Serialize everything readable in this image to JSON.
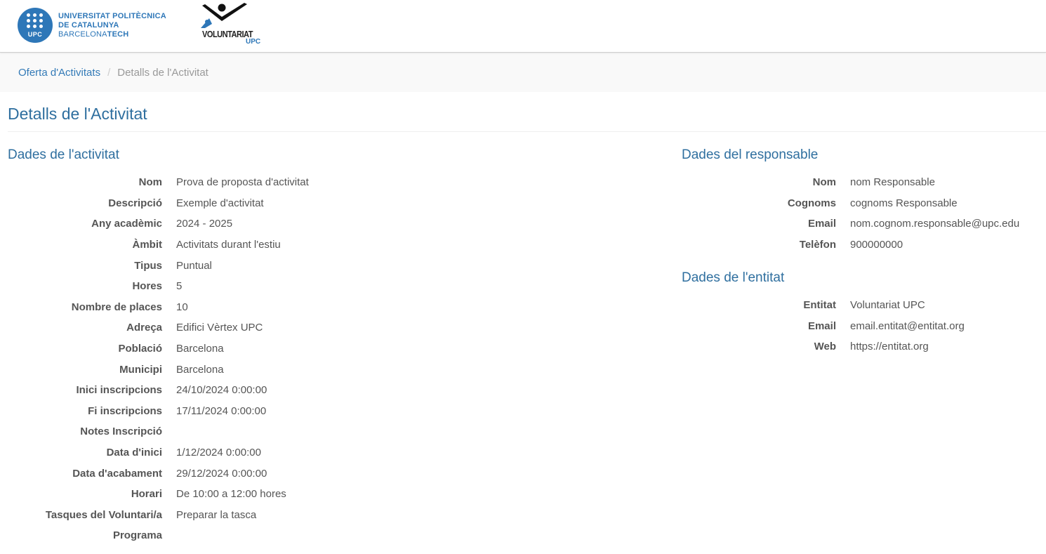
{
  "header": {
    "upc_logo": {
      "circle_text": "UPC",
      "line1": "UNIVERSITAT POLITÈCNICA",
      "line2": "DE CATALUNYA",
      "line3_a": "BARCELONA",
      "line3_b": "TECH"
    },
    "vol_logo": {
      "name": "VOLUNTARIAT",
      "sub": "UPC"
    }
  },
  "breadcrumb": {
    "parent": "Oferta d'Activitats",
    "separator": "/",
    "current": "Detalls de l'Activitat"
  },
  "page_title": "Detalls de l'Activitat",
  "activity": {
    "title": "Dades de l'activitat",
    "rows": [
      {
        "label": "Nom",
        "value": "Prova de proposta d'activitat"
      },
      {
        "label": "Descripció",
        "value": "Exemple d'activitat"
      },
      {
        "label": "Any acadèmic",
        "value": "2024 - 2025"
      },
      {
        "label": "Àmbit",
        "value": "Activitats durant l'estiu"
      },
      {
        "label": "Tipus",
        "value": "Puntual"
      },
      {
        "label": "Hores",
        "value": "5"
      },
      {
        "label": "Nombre de places",
        "value": "10"
      },
      {
        "label": "Adreça",
        "value": "Edifici Vèrtex UPC"
      },
      {
        "label": "Població",
        "value": "Barcelona"
      },
      {
        "label": "Municipi",
        "value": "Barcelona"
      },
      {
        "label": "Inici inscripcions",
        "value": "24/10/2024 0:00:00"
      },
      {
        "label": "Fi inscripcions",
        "value": "17/11/2024 0:00:00"
      },
      {
        "label": "Notes Inscripció",
        "value": ""
      },
      {
        "label": "Data d'inici",
        "value": "1/12/2024 0:00:00"
      },
      {
        "label": "Data d'acabament",
        "value": "29/12/2024 0:00:00"
      },
      {
        "label": "Horari",
        "value": "De 10:00 a 12:00 hores"
      },
      {
        "label": "Tasques del Voluntari/a",
        "value": "Preparar la tasca"
      },
      {
        "label": "Programa",
        "value": ""
      }
    ]
  },
  "responsible": {
    "title": "Dades del responsable",
    "rows": [
      {
        "label": "Nom",
        "value": "nom Responsable"
      },
      {
        "label": "Cognoms",
        "value": "cognoms Responsable"
      },
      {
        "label": "Email",
        "value": "nom.cognom.responsable@upc.edu"
      },
      {
        "label": "Telèfon",
        "value": "900000000"
      }
    ]
  },
  "entity": {
    "title": "Dades de l'entitat",
    "rows": [
      {
        "label": "Entitat",
        "value": "Voluntariat UPC"
      },
      {
        "label": "Email",
        "value": "email.entitat@entitat.org"
      },
      {
        "label": "Web",
        "value": "https://entitat.org"
      }
    ]
  },
  "colors": {
    "brand_blue": "#2e77b8",
    "heading_blue": "#2f6f9f",
    "link_blue": "#337ab7"
  }
}
